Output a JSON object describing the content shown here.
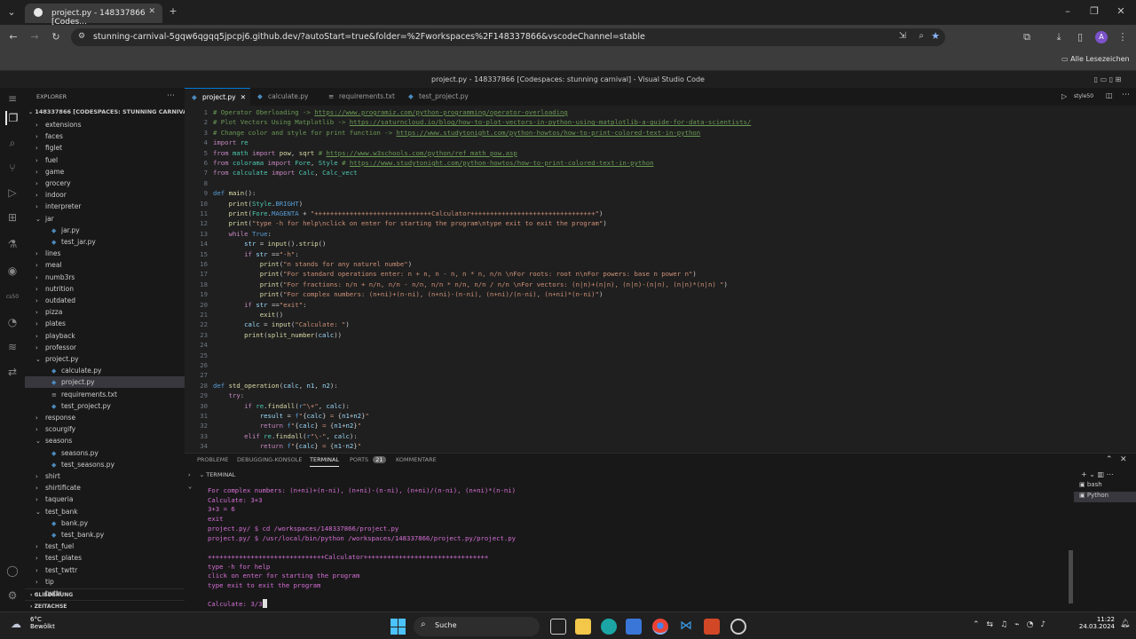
{
  "browser": {
    "tab_title": "project.py - 148337866 [Codes...",
    "url": "stunning-carnival-5gqw6qgqq5jpcpj6.github.dev/?autoStart=true&folder=%2Fworkspaces%2F148337866&vscodeChannel=stable",
    "bookmarks_label": "Alle Lesezeichen",
    "profile_initial": "A"
  },
  "vscode": {
    "window_title": "project.py - 148337866 [Codespaces: stunning carnival] - Visual Studio Code",
    "explorer_label": "EXPLORER",
    "root_label": "148337866 [CODESPACES: STUNNING CARNIVAL]",
    "tree": [
      {
        "label": "extensions",
        "type": "folder",
        "depth": 1,
        "open": false
      },
      {
        "label": "faces",
        "type": "folder",
        "depth": 1,
        "open": false
      },
      {
        "label": "figlet",
        "type": "folder",
        "depth": 1,
        "open": false
      },
      {
        "label": "fuel",
        "type": "folder",
        "depth": 1,
        "open": false
      },
      {
        "label": "game",
        "type": "folder",
        "depth": 1,
        "open": false
      },
      {
        "label": "grocery",
        "type": "folder",
        "depth": 1,
        "open": false
      },
      {
        "label": "indoor",
        "type": "folder",
        "depth": 1,
        "open": false
      },
      {
        "label": "interpreter",
        "type": "folder",
        "depth": 1,
        "open": false
      },
      {
        "label": "jar",
        "type": "folder",
        "depth": 1,
        "open": true
      },
      {
        "label": "jar.py",
        "type": "file",
        "depth": 2
      },
      {
        "label": "test_jar.py",
        "type": "file",
        "depth": 2
      },
      {
        "label": "lines",
        "type": "folder",
        "depth": 1,
        "open": false
      },
      {
        "label": "meal",
        "type": "folder",
        "depth": 1,
        "open": false
      },
      {
        "label": "numb3rs",
        "type": "folder",
        "depth": 1,
        "open": false
      },
      {
        "label": "nutrition",
        "type": "folder",
        "depth": 1,
        "open": false
      },
      {
        "label": "outdated",
        "type": "folder",
        "depth": 1,
        "open": false
      },
      {
        "label": "pizza",
        "type": "folder",
        "depth": 1,
        "open": false
      },
      {
        "label": "plates",
        "type": "folder",
        "depth": 1,
        "open": false
      },
      {
        "label": "playback",
        "type": "folder",
        "depth": 1,
        "open": false
      },
      {
        "label": "professor",
        "type": "folder",
        "depth": 1,
        "open": false
      },
      {
        "label": "project.py",
        "type": "folder",
        "depth": 1,
        "open": true
      },
      {
        "label": "calculate.py",
        "type": "file",
        "depth": 2
      },
      {
        "label": "project.py",
        "type": "file",
        "depth": 2,
        "selected": true
      },
      {
        "label": "requirements.txt",
        "type": "file",
        "depth": 2
      },
      {
        "label": "test_project.py",
        "type": "file",
        "depth": 2
      },
      {
        "label": "response",
        "type": "folder",
        "depth": 1,
        "open": false
      },
      {
        "label": "scourgify",
        "type": "folder",
        "depth": 1,
        "open": false
      },
      {
        "label": "seasons",
        "type": "folder",
        "depth": 1,
        "open": true
      },
      {
        "label": "seasons.py",
        "type": "file",
        "depth": 2
      },
      {
        "label": "test_seasons.py",
        "type": "file",
        "depth": 2
      },
      {
        "label": "shirt",
        "type": "folder",
        "depth": 1,
        "open": false
      },
      {
        "label": "shirtificate",
        "type": "folder",
        "depth": 1,
        "open": false
      },
      {
        "label": "taqueria",
        "type": "folder",
        "depth": 1,
        "open": false
      },
      {
        "label": "test_bank",
        "type": "folder",
        "depth": 1,
        "open": true
      },
      {
        "label": "bank.py",
        "type": "file",
        "depth": 2
      },
      {
        "label": "test_bank.py",
        "type": "file",
        "depth": 2
      },
      {
        "label": "test_fuel",
        "type": "folder",
        "depth": 1,
        "open": false
      },
      {
        "label": "test_plates",
        "type": "folder",
        "depth": 1,
        "open": false
      },
      {
        "label": "test_twttr",
        "type": "folder",
        "depth": 1,
        "open": false
      },
      {
        "label": "tip",
        "type": "folder",
        "depth": 1,
        "open": false
      },
      {
        "label": "twttr",
        "type": "folder",
        "depth": 1,
        "open": false
      }
    ],
    "outline_label": "GLIEDERUNG",
    "timeline_label": "ZEITACHSE",
    "editor_tabs": [
      {
        "label": "project.py",
        "active": true
      },
      {
        "label": "calculate.py",
        "active": false
      },
      {
        "label": "requirements.txt",
        "active": false
      },
      {
        "label": "test_project.py",
        "active": false
      }
    ],
    "editor_actions_label": "style50",
    "code_lines": [
      {
        "n": "1",
        "html": "<span class='cm'># Operator Oberloading -&gt; </span><span class='lk'>https://www.programiz.com/python-programming/operator-overloading</span>"
      },
      {
        "n": "2",
        "html": "<span class='cm'># Plot Vectors Using Matplotlib -&gt; </span><span class='lk'>https://saturncloud.io/blog/how-to-plot-vectors-in-python-using-matplotlib-a-guide-for-data-scientists/</span>"
      },
      {
        "n": "3",
        "html": "<span class='cm'># Change color and style for print function -&gt; </span><span class='lk'>https://www.studytonight.com/python-howtos/how-to-print-colored-text-in-python</span>"
      },
      {
        "n": "4",
        "html": "<span class='kw'>import</span> <span class='cls'>re</span>"
      },
      {
        "n": "5",
        "html": "<span class='kw'>from</span> <span class='cls'>math</span> <span class='kw'>import</span> <span class='fn'>pow</span>, <span class='fn'>sqrt</span> <span class='cm'># </span><span class='lk'>https://www.w3schools.com/python/ref_math_pow.asp</span>"
      },
      {
        "n": "6",
        "html": "<span class='kw'>from</span> <span class='cls'>colorama</span> <span class='kw'>import</span> <span class='cls'>Fore</span>, <span class='cls'>Style</span> <span class='cm'># </span><span class='lk'>https://www.studytonight.com/python-howtos/how-to-print-colored-text-in-python</span>"
      },
      {
        "n": "7",
        "html": "<span class='kw'>from</span> <span class='cls'>calculate</span> <span class='kw'>import</span> <span class='cls'>Calc</span>, <span class='cls'>Calc_vect</span>"
      },
      {
        "n": "8",
        "html": ""
      },
      {
        "n": "9",
        "html": "<span class='bl'>def</span> <span class='fn'>main</span>():"
      },
      {
        "n": "10",
        "html": "    <span class='fn'>print</span>(<span class='cls'>Style</span>.<span class='bl'>BRIGHT</span>)"
      },
      {
        "n": "11",
        "html": "    <span class='fn'>print</span>(<span class='cls'>Fore</span>.<span class='bl'>MAGENTA</span> + <span class='st'>\"++++++++++++++++++++++++++++++Calculator++++++++++++++++++++++++++++++++\"</span>)"
      },
      {
        "n": "12",
        "html": "    <span class='fn'>print</span>(<span class='st'>\"type -h for help\\nclick on enter for starting the program\\ntype exit to exit the program\"</span>)"
      },
      {
        "n": "13",
        "html": "    <span class='kw'>while</span> <span class='bl'>True</span>:"
      },
      {
        "n": "14",
        "html": "        <span class='vr'>str</span> = <span class='fn'>input</span>().<span class='fn'>strip</span>()"
      },
      {
        "n": "15",
        "html": "        <span class='kw'>if</span> <span class='vr'>str</span> ==<span class='st'>\"-h\"</span>:"
      },
      {
        "n": "16",
        "html": "            <span class='fn'>print</span>(<span class='st'>\"n stands for any naturel numbe\"</span>)"
      },
      {
        "n": "17",
        "html": "            <span class='fn'>print</span>(<span class='st'>\"For standard operations enter: n + n, n - n, n * n, n/n \\nFor roots: root n\\nFor powers: base n power n\"</span>)"
      },
      {
        "n": "18",
        "html": "            <span class='fn'>print</span>(<span class='st'>\"For fractions: n/n + n/n, n/n - n/n, n/n * n/n, n/n / n/n \\nFor vectors: (n|n)+(n|n), (n|n)-(n|n), (n|n)*(n|n) \"</span>)"
      },
      {
        "n": "19",
        "html": "            <span class='fn'>print</span>(<span class='st'>\"For complex numbers: (n+ni)+(n-ni), (n+ni)-(n-ni), (n+ni)/(n-ni), (n+ni)*(n-ni)\"</span>)"
      },
      {
        "n": "20",
        "html": "        <span class='kw'>if</span> <span class='vr'>str</span> ==<span class='st'>\"exit\"</span>:"
      },
      {
        "n": "21",
        "html": "            <span class='fn'>exit</span>()"
      },
      {
        "n": "22",
        "html": "        <span class='vr'>calc</span> = <span class='fn'>input</span>(<span class='st'>\"Calculate: \"</span>)"
      },
      {
        "n": "23",
        "html": "        <span class='fn'>print</span>(<span class='fn'>split_number</span>(<span class='vr'>calc</span>))"
      },
      {
        "n": "24",
        "html": ""
      },
      {
        "n": "25",
        "html": ""
      },
      {
        "n": "26",
        "html": ""
      },
      {
        "n": "27",
        "html": ""
      },
      {
        "n": "28",
        "html": "<span class='bl'>def</span> <span class='fn'>std_operation</span>(<span class='vr'>calc</span>, <span class='vr'>n1</span>, <span class='vr'>n2</span>):"
      },
      {
        "n": "29",
        "html": "    <span class='kw'>try</span>:"
      },
      {
        "n": "30",
        "html": "        <span class='kw'>if</span> <span class='cls'>re</span>.<span class='fn'>findall</span>(<span class='bl'>r</span><span class='st'>\"\\+\"</span>, <span class='vr'>calc</span>):"
      },
      {
        "n": "31",
        "html": "            <span class='vr'>result</span> = <span class='bl'>f</span><span class='st'>\"</span>{<span class='vr'>calc</span>}<span class='st'> = </span>{<span class='vr'>n1</span>+<span class='vr'>n2</span>}<span class='st'>\"</span>"
      },
      {
        "n": "32",
        "html": "            <span class='kw'>return</span> <span class='bl'>f</span><span class='st'>\"</span>{<span class='vr'>calc</span>}<span class='st'> = </span>{<span class='vr'>n1</span>+<span class='vr'>n2</span>}<span class='st'>\"</span>"
      },
      {
        "n": "33",
        "html": "        <span class='kw'>elif</span> <span class='cls'>re</span>.<span class='fn'>findall</span>(<span class='bl'>r</span><span class='st'>\"\\-\"</span>, <span class='vr'>calc</span>):"
      },
      {
        "n": "34",
        "html": "            <span class='kw'>return</span> <span class='bl'>f</span><span class='st'>\"</span>{<span class='vr'>calc</span>}<span class='st'> = </span>{<span class='vr'>n1</span>-<span class='vr'>n2</span>}<span class='st'>\"</span>"
      }
    ],
    "panel_tabs": [
      {
        "label": "PROBLEME",
        "active": false
      },
      {
        "label": "DEBUGGING-KONSOLE",
        "active": false
      },
      {
        "label": "TERMINAL",
        "active": true
      },
      {
        "label": "PORTS",
        "active": false,
        "badge": "21"
      },
      {
        "label": "KOMMENTARE",
        "active": false
      }
    ],
    "terminal_header": "TERMINAL",
    "terminal_lines": [
      "For complex numbers: (n+ni)+(n-ni), (n+ni)-(n-ni), (n+ni)/(n-ni), (n+ni)*(n-ni)",
      "Calculate: 3+3",
      "3+3 = 6",
      "exit",
      "project.py/ $ cd /workspaces/148337866/project.py",
      "project.py/ $ /usr/local/bin/python /workspaces/148337866/project.py/project.py",
      "",
      "++++++++++++++++++++++++++++++Calculator++++++++++++++++++++++++++++++++",
      "type -h for help",
      "click on enter for starting the program",
      "type exit to exit the program",
      "",
      "Calculate: 3/3"
    ],
    "terminal_sessions": [
      "bash",
      "Python"
    ]
  },
  "taskbar": {
    "weather_temp": "6°C",
    "weather_desc": "Bewölkt",
    "search_label": "Suche",
    "time": "11:22",
    "date": "24.03.2024"
  },
  "colors": {
    "accent": "#0078d4",
    "terminal_text": "#d670d6"
  }
}
